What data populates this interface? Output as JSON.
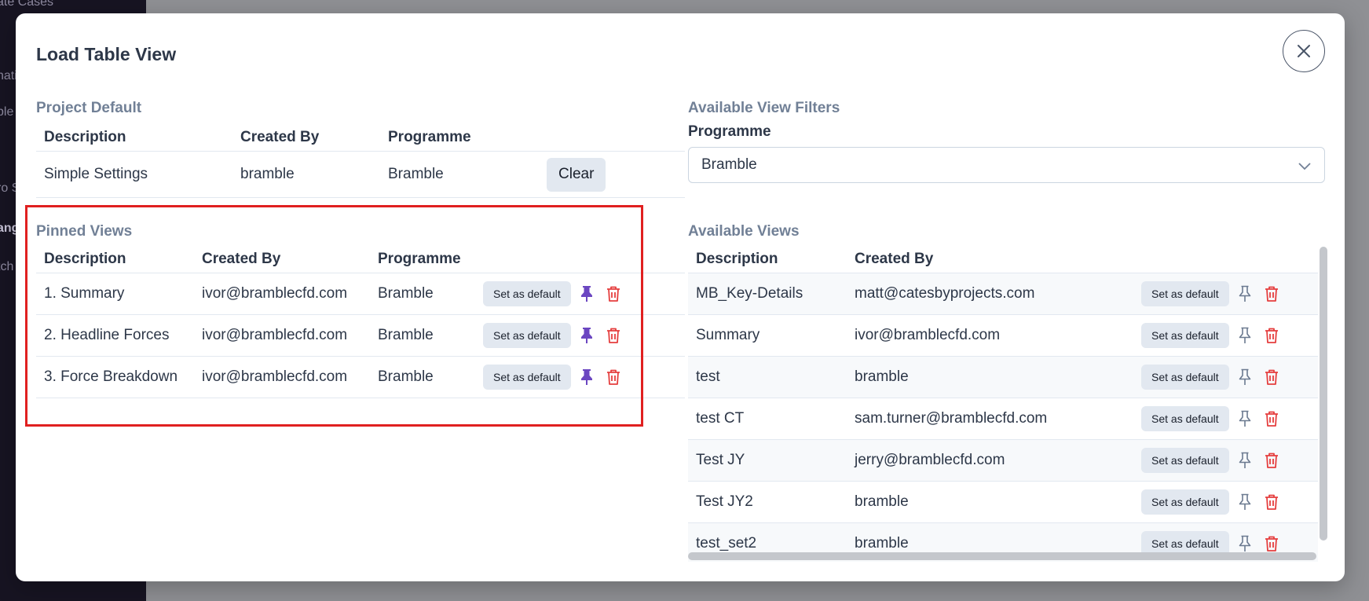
{
  "background": {
    "sidebar_fragments": [
      "ate Cases",
      "nati",
      "ble",
      "ro S",
      "ang",
      "tch"
    ]
  },
  "modal": {
    "title": "Load Table View",
    "close_label": "×"
  },
  "project_default": {
    "section_label": "Project Default",
    "columns": [
      "Description",
      "Created By",
      "Programme"
    ],
    "row": {
      "description": "Simple Settings",
      "created_by": "bramble",
      "programme": "Bramble"
    },
    "clear_label": "Clear"
  },
  "pinned_views": {
    "section_label": "Pinned Views",
    "columns": [
      "Description",
      "Created By",
      "Programme"
    ],
    "set_default_label": "Set as default",
    "rows": [
      {
        "description": "1. Summary",
        "created_by": "ivor@bramblecfd.com",
        "programme": "Bramble"
      },
      {
        "description": "2. Headline Forces",
        "created_by": "ivor@bramblecfd.com",
        "programme": "Bramble"
      },
      {
        "description": "3. Force Breakdown",
        "created_by": "ivor@bramblecfd.com",
        "programme": "Bramble"
      }
    ]
  },
  "filters": {
    "section_label": "Available View Filters",
    "programme_label": "Programme",
    "programme_value": "Bramble"
  },
  "available_views": {
    "section_label": "Available Views",
    "columns": [
      "Description",
      "Created By"
    ],
    "set_default_label": "Set as default",
    "rows": [
      {
        "description": "MB_Key-Details",
        "created_by": "matt@catesbyprojects.com"
      },
      {
        "description": "Summary",
        "created_by": "ivor@bramblecfd.com"
      },
      {
        "description": "test",
        "created_by": "bramble"
      },
      {
        "description": "test CT",
        "created_by": "sam.turner@bramblecfd.com"
      },
      {
        "description": "Test JY",
        "created_by": "jerry@bramblecfd.com"
      },
      {
        "description": "Test JY2",
        "created_by": "bramble"
      },
      {
        "description": "test_set2",
        "created_by": "bramble"
      }
    ]
  },
  "colors": {
    "pin_active": "#6b46c1",
    "pin_inactive": "#6b7a90",
    "delete": "#e53e3e",
    "highlight_box": "#e02020"
  }
}
